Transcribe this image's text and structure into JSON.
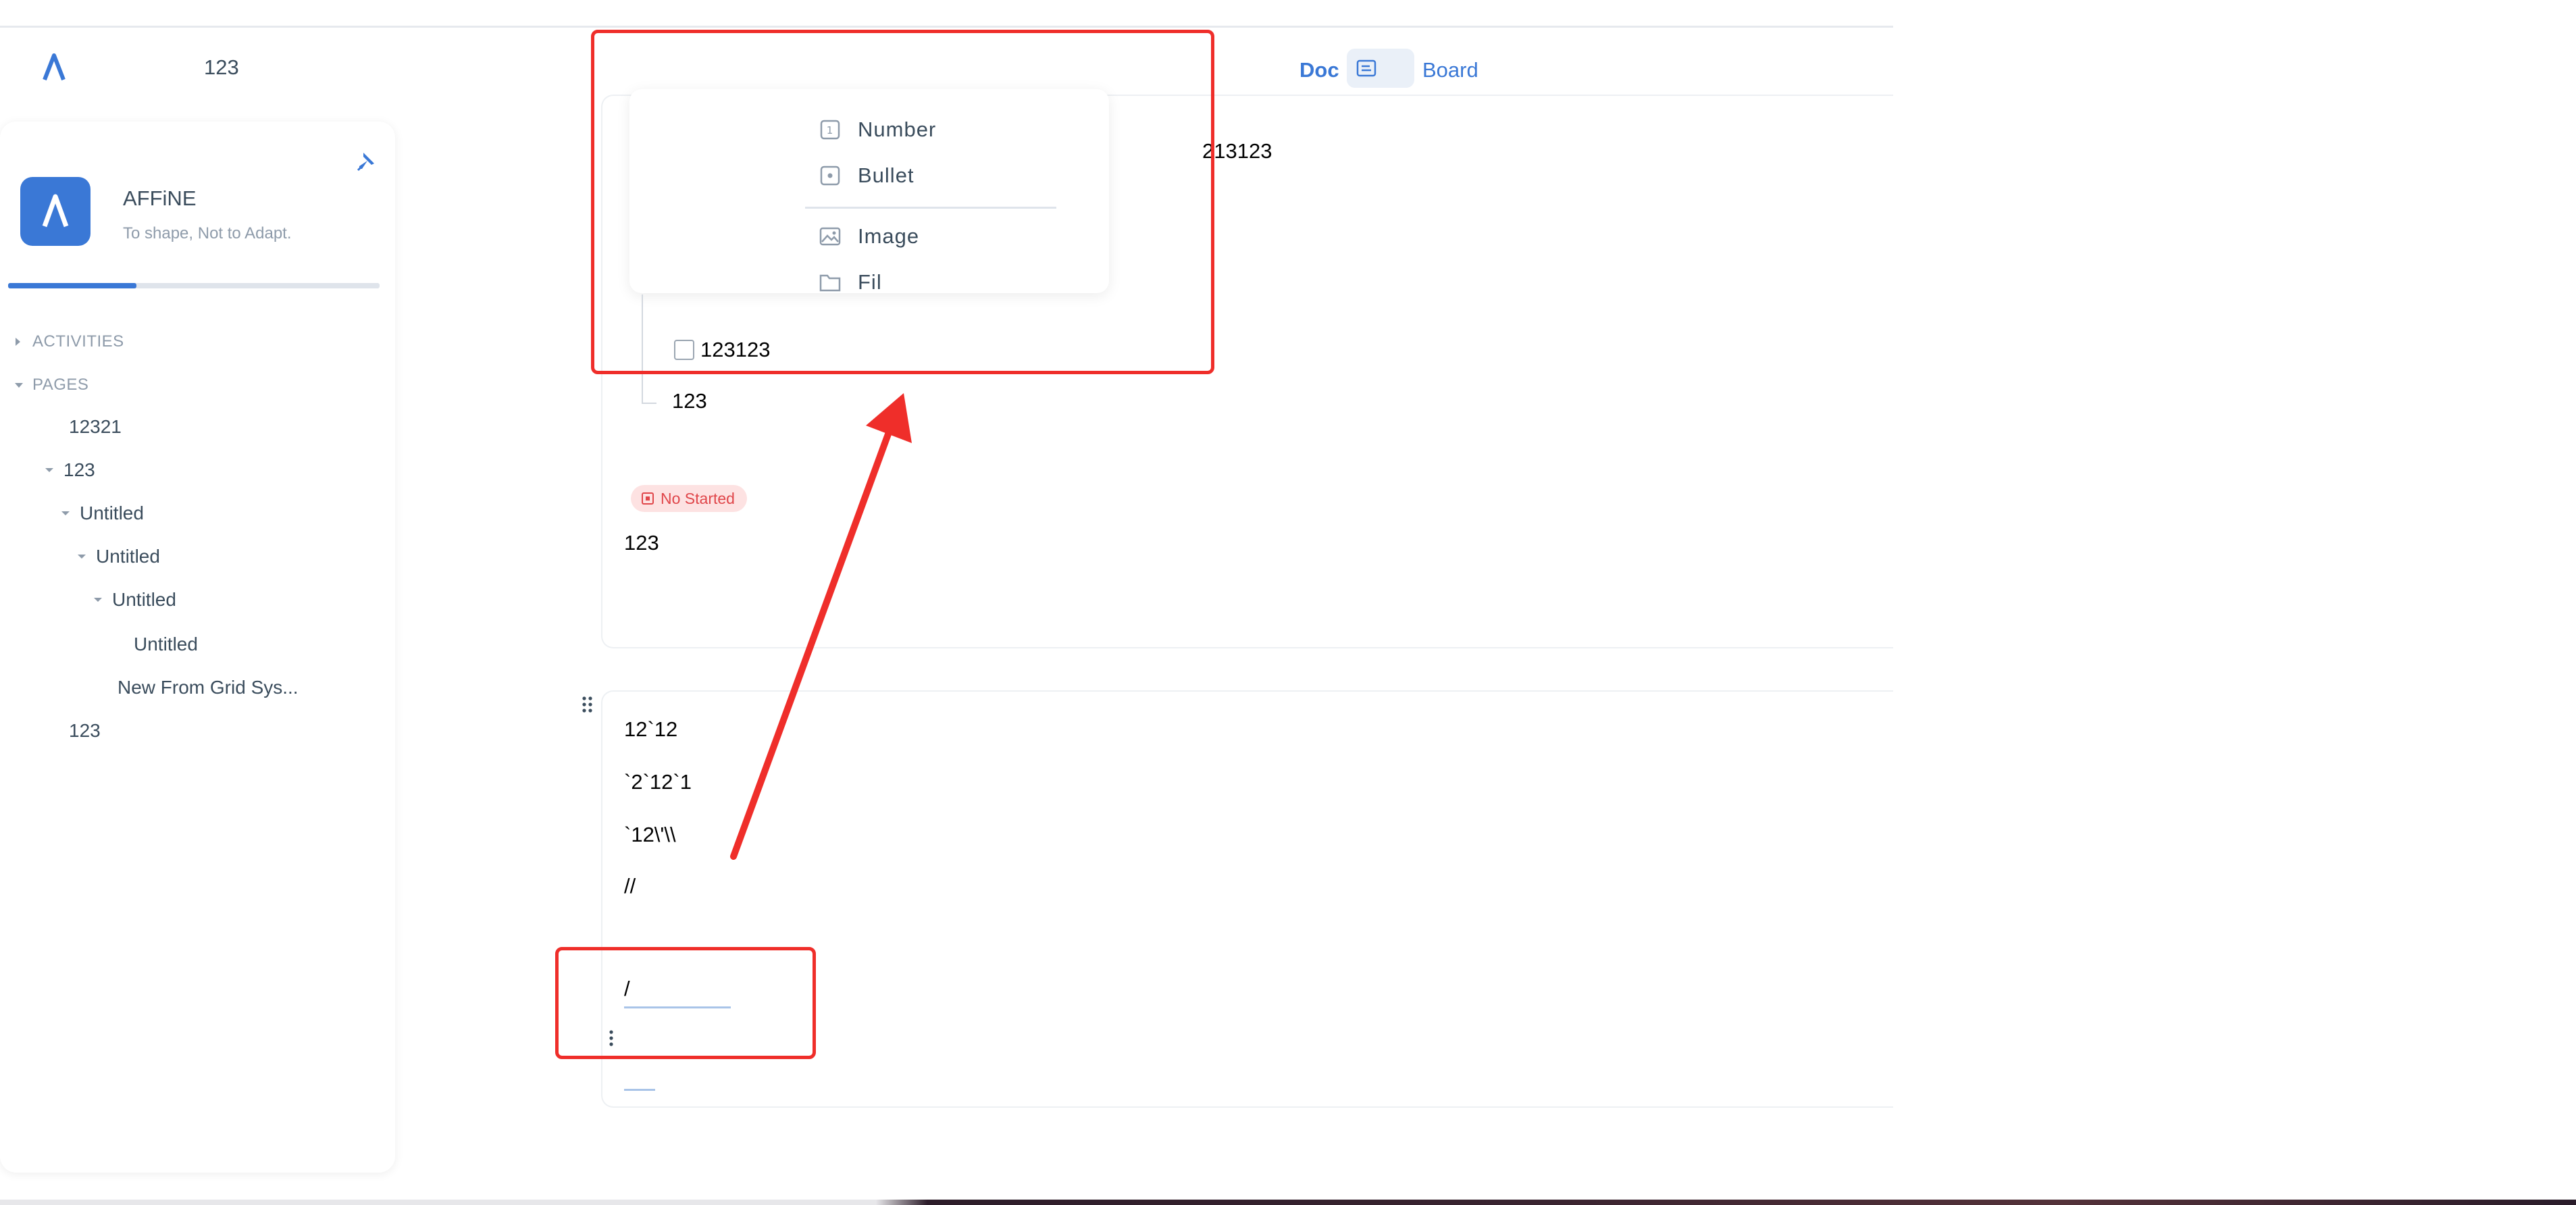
{
  "header": {
    "title": "123",
    "mode_doc": "Doc",
    "mode_board": "Board"
  },
  "sidebar": {
    "workspace_name": "AFFiNE",
    "workspace_slogan": "To shape, Not to Adapt.",
    "progress_fraction": 0.345,
    "sections": {
      "activities": "ACTIVITIES",
      "pages": "PAGES"
    },
    "pages": [
      {
        "label": "12321"
      },
      {
        "label": "123"
      },
      {
        "label": "Untitled"
      },
      {
        "label": "Untitled"
      },
      {
        "label": "Untitled"
      },
      {
        "label": "Untitled"
      },
      {
        "label": "New From Grid Sys..."
      },
      {
        "label": "123"
      }
    ]
  },
  "slash_menu": {
    "items": [
      {
        "label": "Number",
        "icon": "numbered-list-icon"
      },
      {
        "label": "Bullet",
        "icon": "bullet-list-icon"
      },
      {
        "label": "Image",
        "icon": "image-icon"
      },
      {
        "label": "Fil",
        "icon": "file-icon"
      }
    ]
  },
  "editor": {
    "card1": {
      "floating_text": "213123",
      "todo_text": "123123",
      "child_text": "123",
      "status_badge": "No Started",
      "paragraph": "123"
    },
    "card2": {
      "lines": [
        "12`12",
        "`2`12`1",
        "`12\\'\\\\",
        "//"
      ],
      "slash_input": "/"
    }
  },
  "colors": {
    "accent": "#3a78d6",
    "annotation": "#ef2e2a",
    "badge_bg": "#fde2e2",
    "badge_text": "#e0464a"
  }
}
